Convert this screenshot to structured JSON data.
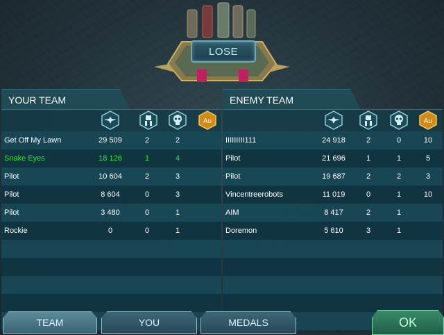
{
  "result": "LOSE",
  "your_team": {
    "title": "YOUR TEAM",
    "columns": [
      "winged-insignia-icon",
      "mech-icon",
      "skull-icon",
      "gold-medal-icon"
    ],
    "rows": [
      {
        "name": "Get Off My Lawn",
        "score": "29 509",
        "c1": "2",
        "c2": "2",
        "c3": "",
        "highlight": false
      },
      {
        "name": "Snake Eyes",
        "score": "18 126",
        "c1": "1",
        "c2": "4",
        "c3": "",
        "highlight": true
      },
      {
        "name": "Pilot",
        "score": "10 604",
        "c1": "2",
        "c2": "3",
        "c3": "",
        "highlight": false
      },
      {
        "name": "Pilot",
        "score": "8 604",
        "c1": "0",
        "c2": "3",
        "c3": "",
        "highlight": false
      },
      {
        "name": "Pilot",
        "score": "3 480",
        "c1": "0",
        "c2": "1",
        "c3": "",
        "highlight": false
      },
      {
        "name": "Rockie",
        "score": "0",
        "c1": "0",
        "c2": "1",
        "c3": "",
        "highlight": false
      }
    ]
  },
  "enemy_team": {
    "title": "ENEMY TEAM",
    "columns": [
      "winged-insignia-icon",
      "mech-icon",
      "skull-icon",
      "gold-medal-icon"
    ],
    "rows": [
      {
        "name": "IIIIIIIII111",
        "score": "24 918",
        "c1": "2",
        "c2": "0",
        "c3": "10"
      },
      {
        "name": "Pilot",
        "score": "21 696",
        "c1": "1",
        "c2": "1",
        "c3": "5"
      },
      {
        "name": "Pilot",
        "score": "19 687",
        "c1": "2",
        "c2": "2",
        "c3": "3"
      },
      {
        "name": "Vincentreerobots",
        "score": "11 019",
        "c1": "0",
        "c2": "1",
        "c3": "10"
      },
      {
        "name": "AIM",
        "score": "8 417",
        "c1": "2",
        "c2": "1",
        "c3": ""
      },
      {
        "name": "Doremon",
        "score": "5 610",
        "c1": "3",
        "c2": "1",
        "c3": ""
      }
    ]
  },
  "buttons": {
    "team": "TEAM",
    "you": "YOU",
    "medals": "MEDALS",
    "ok": "OK"
  }
}
